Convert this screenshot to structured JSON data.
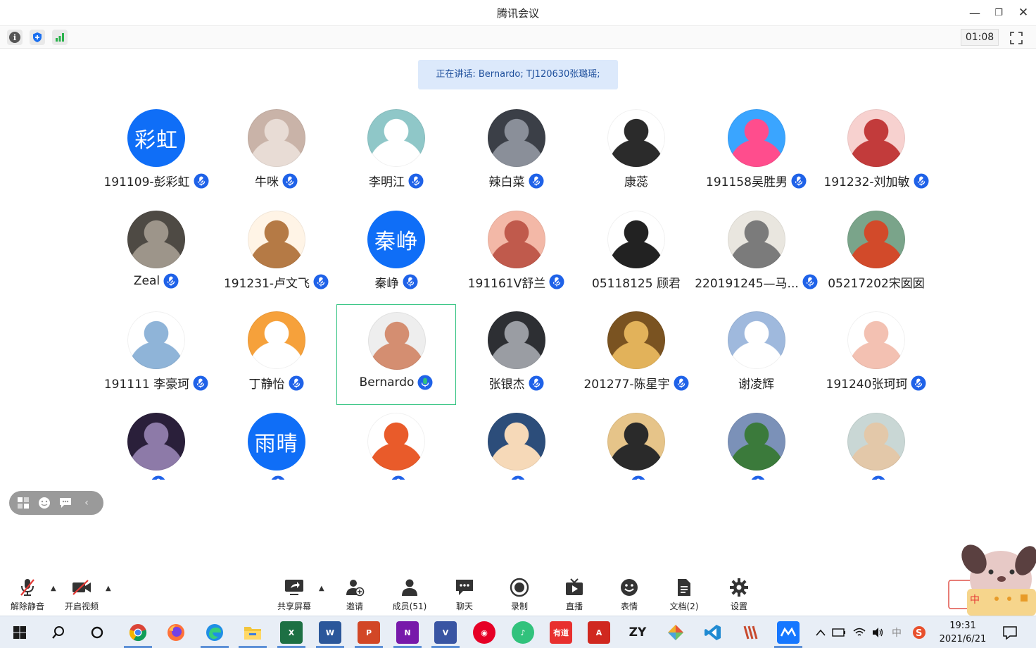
{
  "window": {
    "title": "腾讯会议",
    "timer": "01:08"
  },
  "speaking_banner": "正在讲话: Bernardo; TJ120630张璐瑶;",
  "participants": [
    {
      "name": "191109-彭彩虹",
      "avatar_text": "彩虹",
      "mic": "muted"
    },
    {
      "name": "牛咪",
      "mic": "muted"
    },
    {
      "name": "李明江",
      "mic": "muted"
    },
    {
      "name": "辣白菜",
      "mic": "muted"
    },
    {
      "name": "康蕊",
      "mic": "none"
    },
    {
      "name": "191158吴胜男",
      "mic": "muted"
    },
    {
      "name": "191232-刘加敏",
      "mic": "muted"
    },
    {
      "name": "Zeal",
      "mic": "muted"
    },
    {
      "name": "191231-卢文飞",
      "mic": "muted"
    },
    {
      "name": "秦峥",
      "avatar_text": "秦峥",
      "mic": "muted"
    },
    {
      "name": "191161V舒兰",
      "mic": "muted"
    },
    {
      "name": "05118125 顾君",
      "mic": "none"
    },
    {
      "name": "220191245—马...",
      "mic": "muted"
    },
    {
      "name": "05217202宋囡囡",
      "mic": "none"
    },
    {
      "name": "191111 李豪珂",
      "mic": "muted"
    },
    {
      "name": "丁静怡",
      "mic": "muted"
    },
    {
      "name": "Bernardo",
      "mic": "speaking",
      "active": true
    },
    {
      "name": "张银杰",
      "mic": "muted"
    },
    {
      "name": "201277-陈星宇",
      "mic": "muted"
    },
    {
      "name": "谢凌辉",
      "mic": "none"
    },
    {
      "name": "191240张珂珂",
      "mic": "muted"
    },
    {
      "name": "",
      "mic": "muted"
    },
    {
      "name": "",
      "avatar_text": "雨晴",
      "mic": "muted"
    },
    {
      "name": "",
      "mic": "muted"
    },
    {
      "name": "",
      "mic": "muted"
    },
    {
      "name": "",
      "mic": "muted"
    },
    {
      "name": "",
      "mic": "muted"
    },
    {
      "name": "",
      "mic": "muted"
    }
  ],
  "toolbar": {
    "unmute": "解除静音",
    "start_video": "开启视频",
    "share_screen": "共享屏幕",
    "invite": "邀请",
    "members": "成员(51)",
    "chat": "聊天",
    "record": "录制",
    "live": "直播",
    "reactions": "表情",
    "docs": "文档(2)",
    "settings": "设置"
  },
  "taskbar": {
    "time": "19:31",
    "date": "2021/6/21",
    "ime": "中",
    "apps": [
      "windows-start",
      "search",
      "cortana",
      "chrome",
      "firefox",
      "edge",
      "file-explorer",
      "excel",
      "word",
      "powerpoint",
      "onenote",
      "visio",
      "netease-music",
      "qq-music",
      "youdao",
      "acrobat",
      "zy",
      "sketch",
      "vscode",
      "wps",
      "tencent-meeting"
    ]
  },
  "colors": {
    "accent": "#0f6ef7",
    "active_border": "#2ec27e",
    "speaking_bg": "#dce9fb"
  }
}
